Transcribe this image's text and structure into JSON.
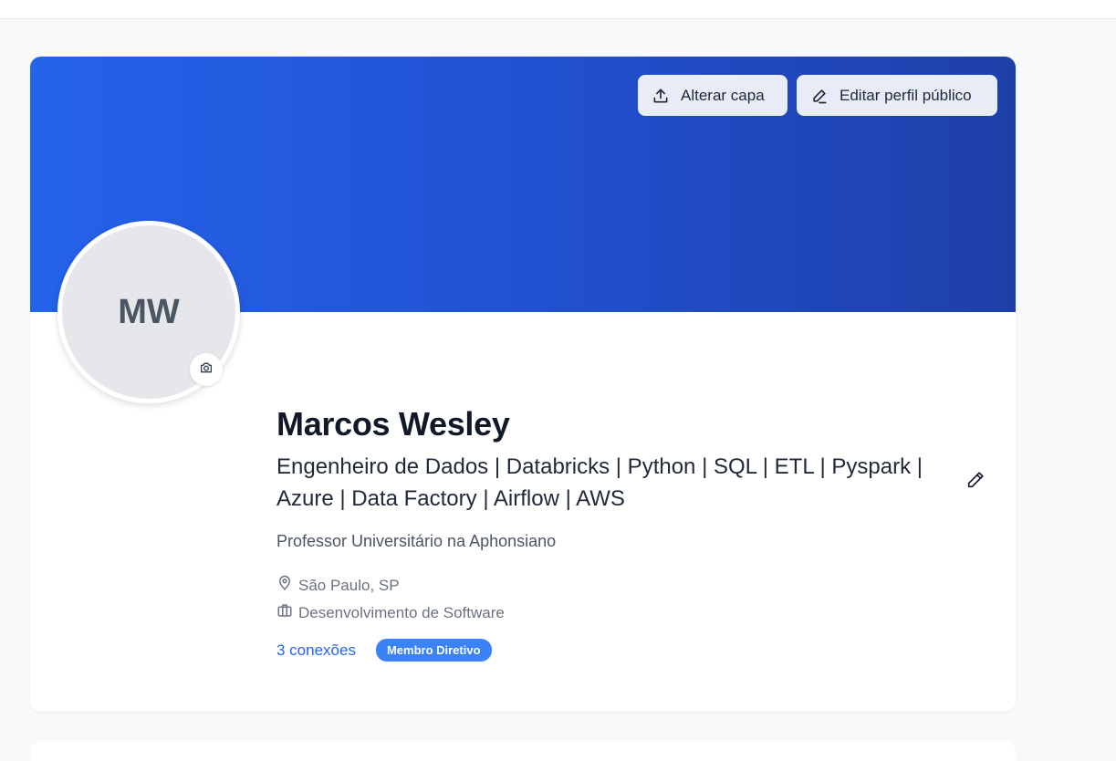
{
  "profile": {
    "initials": "MW",
    "name": "Marcos Wesley",
    "headline": "Engenheiro de Dados | Databricks | Python | SQL | ETL | Pyspark | Azure | Data Factory | Airflow | AWS",
    "job": "Professor Universitário na Aphonsiano",
    "location": "São Paulo, SP",
    "industry": "Desenvolvimento de Software",
    "connections": "3 conexões",
    "badge": "Membro Diretivo"
  },
  "cover": {
    "change_cover_label": "Alterar capa",
    "edit_public_profile_label": "Editar perfil público"
  },
  "icons": {
    "upload": "upload-icon",
    "pencil": "pencil-icon",
    "camera": "camera-icon",
    "location": "map-pin-icon",
    "industry": "briefcase-icon"
  },
  "colors": {
    "cover_start": "#2563eb",
    "cover_end": "#1e3fa8",
    "link": "#2563eb",
    "badge_bg": "#3b82f6"
  }
}
